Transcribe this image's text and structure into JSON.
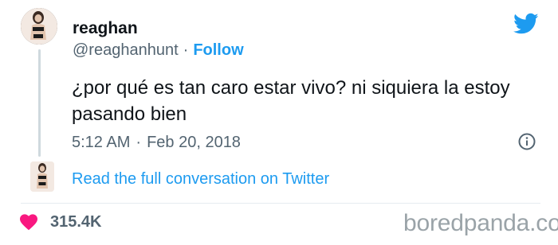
{
  "user": {
    "name": "reaghan",
    "handle": "@reaghanhunt",
    "separator": "·",
    "follow_label": "Follow"
  },
  "tweet": {
    "text": "¿por qué es tan caro estar vivo? ni siquiera la estoy pasando bien",
    "time": "5:12 AM",
    "date": "Feb 20, 2018",
    "separator": "·"
  },
  "conversation_link": "Read the full conversation on Twitter",
  "engagement": {
    "likes": "315.4K"
  },
  "watermark": "boredpanda.com",
  "colors": {
    "link": "#1d9bf0",
    "heart": "#f91880",
    "secondary_text": "#536471"
  },
  "icons": [
    "twitter-bird-icon",
    "info-icon",
    "heart-icon"
  ]
}
